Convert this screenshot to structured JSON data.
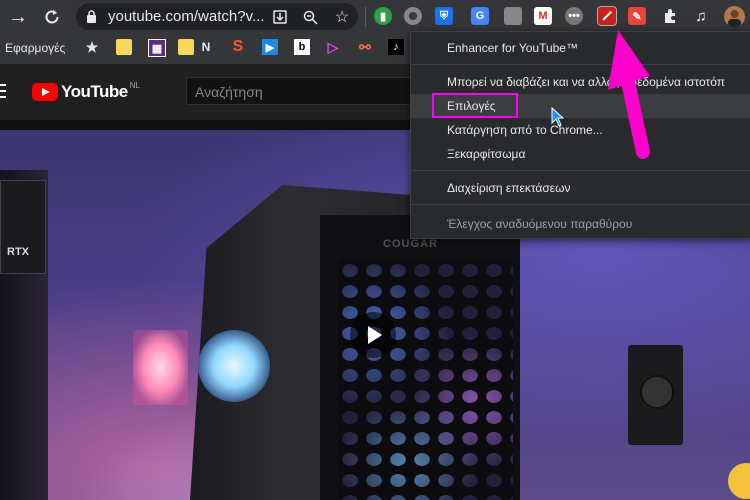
{
  "browser": {
    "url": "youtube.com/watch?v...",
    "bookmarks_label": "Εφαρμογές",
    "bookmark_letter": "N",
    "colors": {
      "toolbar": "#35363a",
      "omnibox": "#202124",
      "highlight": "#ff00ff"
    }
  },
  "youtube": {
    "logo_text": "YouTube",
    "region": "NL",
    "search_placeholder": "Αναζήτηση",
    "video_brand": "COUGAR",
    "rtx_label": "RTX"
  },
  "menu": {
    "title": "Enhancer for YouTube™",
    "items": [
      {
        "label": "Μπορεί να διαβάζει και να αλλάζει δεδομένα ιστοτόπ"
      },
      {
        "label": "Επιλογές"
      },
      {
        "label": "Κατάργηση από το Chrome..."
      },
      {
        "label": "Ξεκαρφίτσωμα"
      },
      {
        "label": "Διαχείριση επεκτάσεων"
      },
      {
        "label": "Έλεγχος αναδυόμενου παραθύρου"
      }
    ]
  }
}
